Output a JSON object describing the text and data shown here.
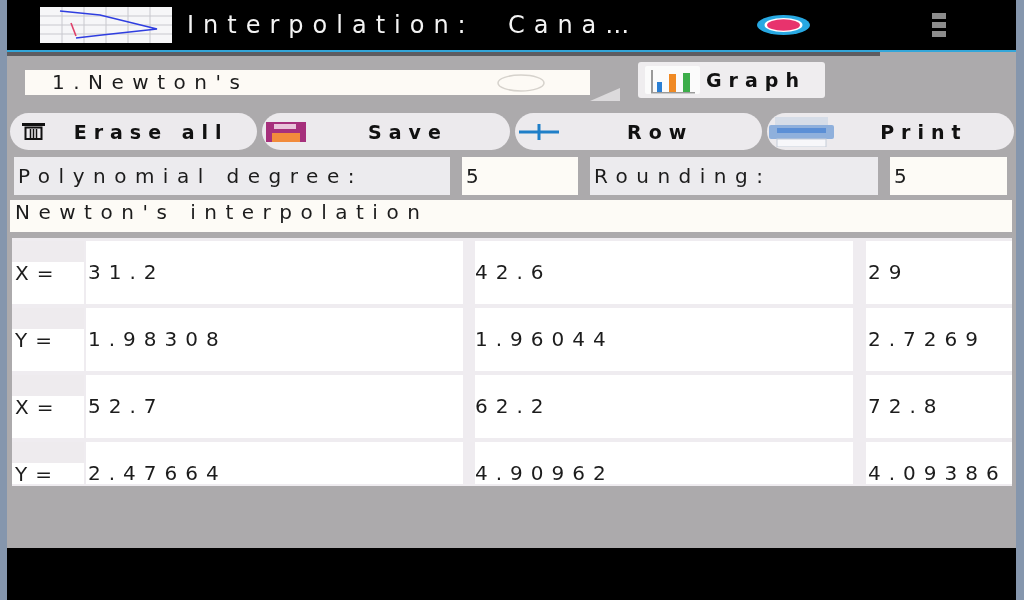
{
  "app_bar": {
    "title": "Interpolation:  Cana…"
  },
  "method_dropdown": {
    "value": "1.Newton's"
  },
  "graph_button": {
    "label": "Graph"
  },
  "toolbar_buttons": [
    {
      "kind": "erase",
      "label": "Erase all"
    },
    {
      "kind": "save",
      "label": "Save"
    },
    {
      "kind": "add",
      "label": "Row"
    },
    {
      "kind": "print",
      "label": "Print"
    }
  ],
  "settings": [
    {
      "label": "Polynomial degree:",
      "value": "5"
    },
    {
      "label": "Rounding:",
      "value": "5"
    }
  ],
  "result": {
    "text": "Newton's interpolation"
  },
  "table": {
    "rows": [
      {
        "label": "X=",
        "cells": [
          "31.2",
          "42.6",
          "29"
        ]
      },
      {
        "label": "Y=",
        "cells": [
          "1.98308",
          "1.96044",
          "2.7269"
        ]
      },
      {
        "label": "X=",
        "cells": [
          "52.7",
          "62.2",
          "72.8"
        ]
      },
      {
        "label": "Y=",
        "cells": [
          "2.47664",
          "4.90962",
          "4.09386"
        ]
      }
    ]
  }
}
